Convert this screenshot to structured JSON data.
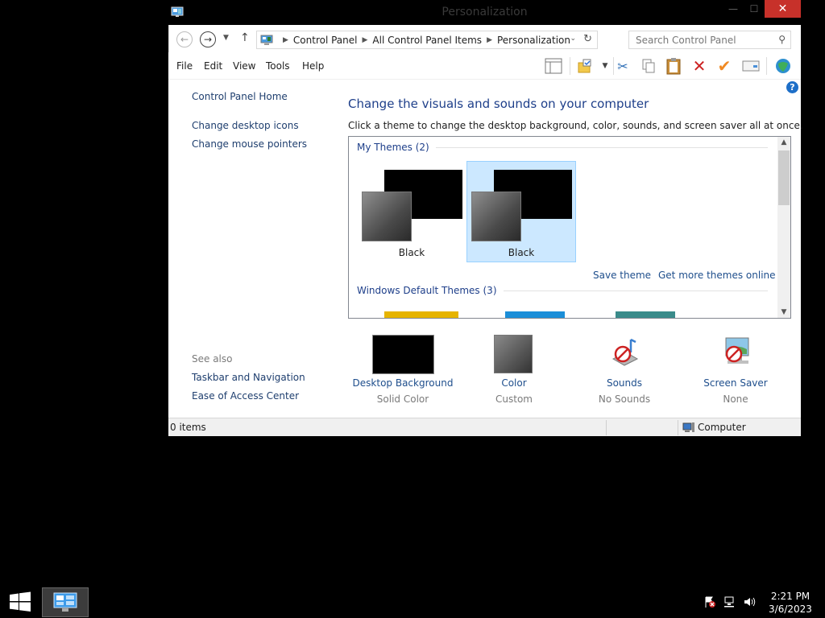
{
  "window": {
    "title": "Personalization",
    "minimize_glyph": "—",
    "maximize_glyph": "☐",
    "close_glyph": "✕"
  },
  "address": {
    "breadcrumb": [
      "Control Panel",
      "All Control Panel Items",
      "Personalization"
    ],
    "search_placeholder": "Search Control Panel"
  },
  "menu": [
    "File",
    "Edit",
    "View",
    "Tools",
    "Help"
  ],
  "toolbar_icons": [
    "layout-icon",
    "folder-options-icon",
    "cut-icon",
    "copy-icon",
    "paste-icon",
    "delete-icon",
    "checkmark-icon",
    "properties-icon",
    "globe-icon"
  ],
  "left_pane": {
    "home": "Control Panel Home",
    "links": [
      "Change desktop icons",
      "Change mouse pointers"
    ],
    "see_also_label": "See also",
    "see_also": [
      "Taskbar and Navigation",
      "Ease of Access Center"
    ]
  },
  "main": {
    "heading": "Change the visuals and sounds on your computer",
    "subtitle": "Click a theme to change the desktop background, color, sounds, and screen saver all at once.",
    "my_themes_label": "My Themes (2)",
    "themes": [
      {
        "name": "Black",
        "selected": false
      },
      {
        "name": "Black",
        "selected": true
      }
    ],
    "save_theme": "Save theme",
    "get_more": "Get more themes online",
    "default_themes_label": "Windows Default Themes (3)"
  },
  "settings": [
    {
      "title": "Desktop Background",
      "value": "Solid Color"
    },
    {
      "title": "Color",
      "value": "Custom"
    },
    {
      "title": "Sounds",
      "value": "No Sounds"
    },
    {
      "title": "Screen Saver",
      "value": "None"
    }
  ],
  "status": {
    "items": "0 items",
    "location": "Computer"
  },
  "taskbar": {
    "time": "2:21 PM",
    "date": "3/6/2023"
  },
  "colors": {
    "link": "#1e4e8c",
    "heading": "#1e3f8a",
    "selection": "#cce8ff",
    "close_button": "#c7312a"
  }
}
